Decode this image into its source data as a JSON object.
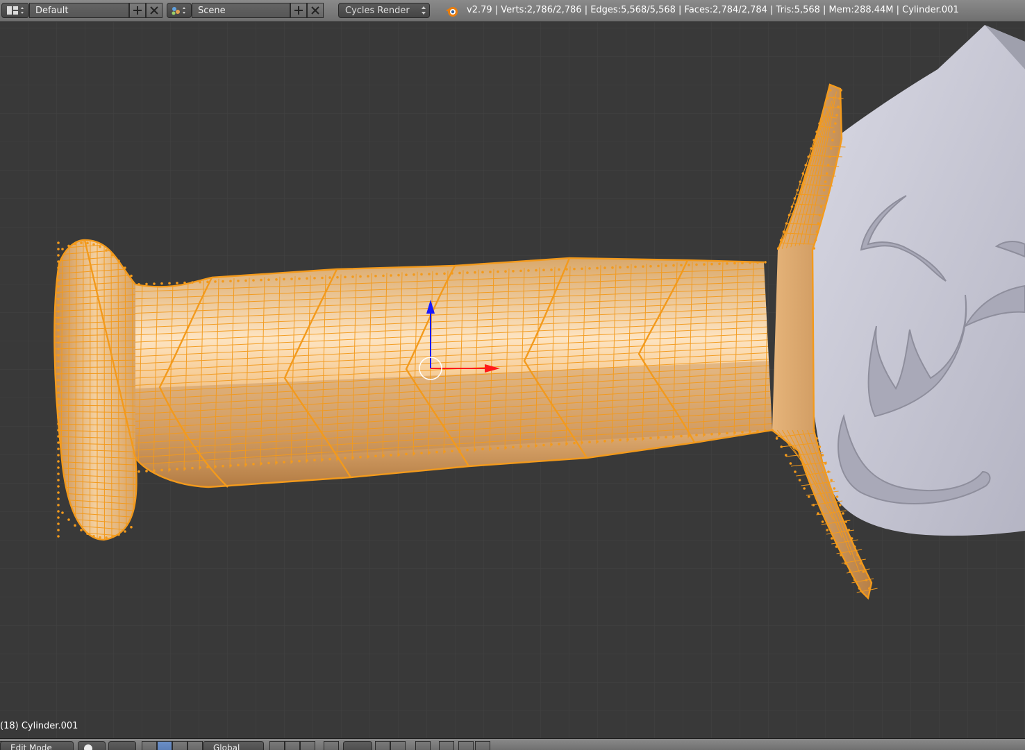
{
  "header": {
    "screen_layout": "Default",
    "scene": "Scene",
    "render_engine": "Cycles Render",
    "stats": "v2.79 | Verts:2,786/2,786 | Edges:5,568/5,568 | Faces:2,784/2,784 | Tris:5,568 | Mem:288.44M | Cylinder.001"
  },
  "viewport": {
    "object_label": "(18) Cylinder.001",
    "selection_color": "#f5921e",
    "background_color": "#393939"
  },
  "footer": {
    "mode": "Edit Mode",
    "orientation": "Global"
  },
  "icons": [
    "screen-layout-icon",
    "scene-icon",
    "add-icon",
    "close-icon",
    "blender-logo-icon",
    "mode-icon",
    "shading-icon",
    "pivot-icon",
    "manipulator-icon",
    "snap-icon"
  ]
}
